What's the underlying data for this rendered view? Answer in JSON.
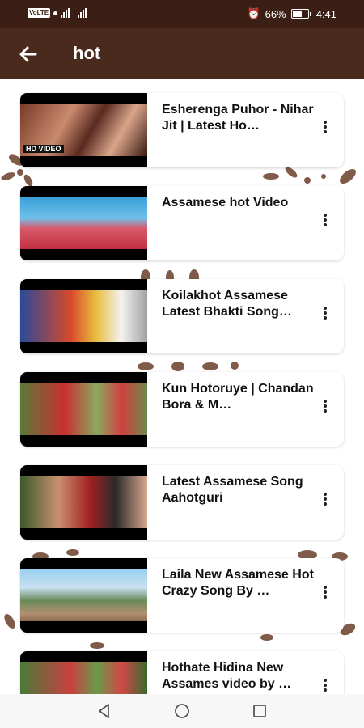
{
  "status_bar": {
    "network_label": "VoLTE",
    "battery_percent": "66%",
    "time": "4:41"
  },
  "app_bar": {
    "title": "hot"
  },
  "videos": [
    {
      "title": "Esherenga Puhor - Nihar Jit | Latest Ho…",
      "thumb_text": "HD VIDEO"
    },
    {
      "title": "Assamese hot Video"
    },
    {
      "title": "Koilakhot Assamese Latest Bhakti Song…"
    },
    {
      "title": "Kun Hotoruye | Chandan Bora & M…"
    },
    {
      "title": "Latest Assamese Song Aahotguri"
    },
    {
      "title": "Laila New Assamese Hot Crazy Song By …"
    },
    {
      "title": "Hothate Hidina New Assames video by …"
    }
  ],
  "colors": {
    "status_bar": "#3b1f14",
    "app_bar": "#4a2a1d",
    "decor": "#6b3f2a"
  }
}
